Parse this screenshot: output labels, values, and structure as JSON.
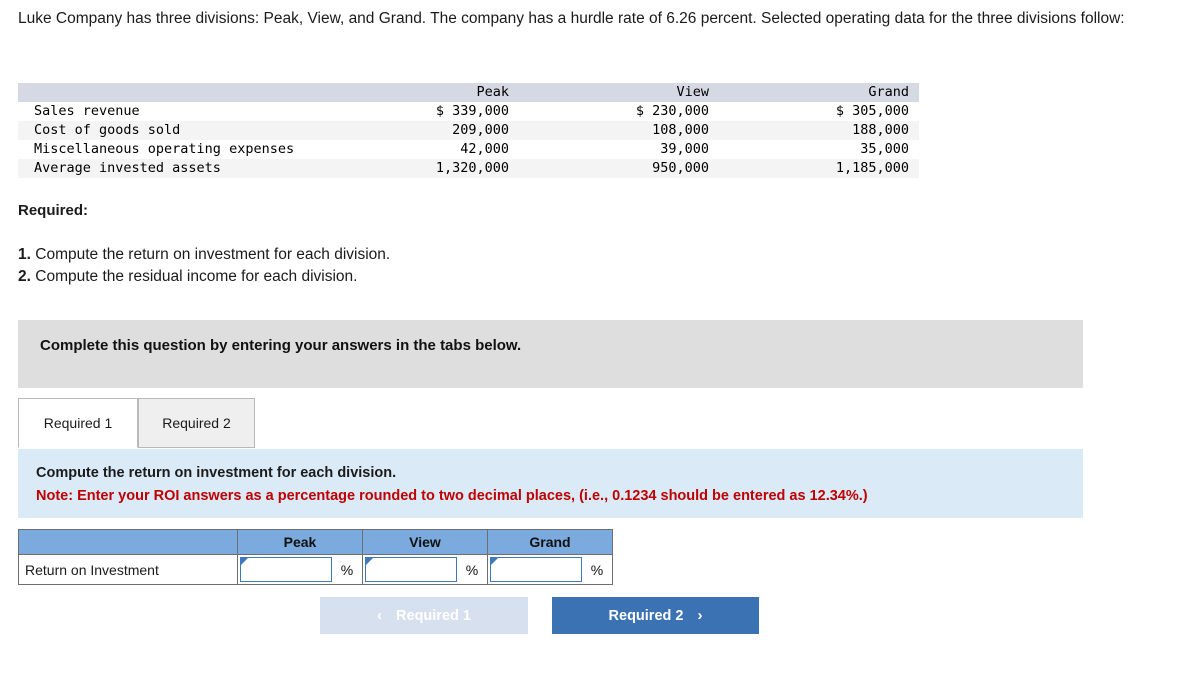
{
  "intro": {
    "text": "Luke Company has three divisions: Peak, View, and Grand. The company has a hurdle rate of 6.26 percent. Selected operating data for the three divisions follow:"
  },
  "data_table": {
    "columns": [
      "",
      "Peak",
      "View",
      "Grand"
    ],
    "rows": [
      {
        "label": "Sales revenue",
        "peak": "$ 339,000",
        "view": "$ 230,000",
        "grand": "$ 305,000"
      },
      {
        "label": "Cost of goods sold",
        "peak": "209,000",
        "view": "108,000",
        "grand": "188,000"
      },
      {
        "label": "Miscellaneous operating expenses",
        "peak": "42,000",
        "view": "39,000",
        "grand": "35,000"
      },
      {
        "label": "Average invested assets",
        "peak": "1,320,000",
        "view": "950,000",
        "grand": "1,185,000"
      }
    ]
  },
  "required": {
    "heading": "Required:",
    "items": [
      {
        "num": "1.",
        "text": "Compute the return on investment for each division."
      },
      {
        "num": "2.",
        "text": "Compute the residual income for each division."
      }
    ]
  },
  "banner": {
    "text": "Complete this question by entering your answers in the tabs below."
  },
  "tabs": [
    {
      "label": "Required 1",
      "active": true
    },
    {
      "label": "Required 2",
      "active": false
    }
  ],
  "instructions": {
    "line1": "Compute the return on investment for each division.",
    "line2": "Note: Enter your ROI answers as a percentage rounded to two decimal places, (i.e., 0.1234 should be entered as 12.34%.)"
  },
  "answer_table": {
    "headers": [
      "",
      "Peak",
      "View",
      "Grand"
    ],
    "row_label": "Return on Investment",
    "unit_suffix": "%",
    "values": {
      "peak": "",
      "view": "",
      "grand": ""
    }
  },
  "nav": {
    "prev_label": "Required 1",
    "prev_icon": "chevron-left-icon",
    "prev_chevron": "‹",
    "next_label": "Required 2",
    "next_icon": "chevron-right-icon",
    "next_chevron": "›"
  },
  "colors": {
    "header_blue": "#7aaade",
    "panel_blue": "#daeaf7",
    "banner_gray": "#dedede",
    "primary_button": "#3b72b4",
    "disabled_button": "#d6e0ef",
    "note_red": "#c00000",
    "table_header_gray": "#d5d9e3"
  }
}
